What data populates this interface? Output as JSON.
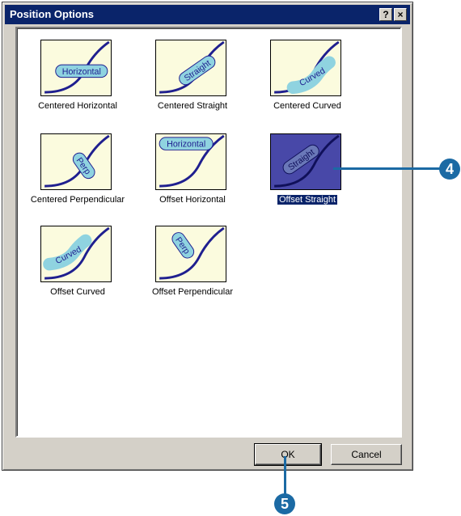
{
  "dialog": {
    "title": "Position Options",
    "help_label": "?",
    "close_label": "×"
  },
  "options": [
    {
      "label": "Centered Horizontal",
      "badge": "Horizontal",
      "selected": false
    },
    {
      "label": "Centered Straight",
      "badge": "Straight",
      "selected": false
    },
    {
      "label": "Centered Curved",
      "badge": "Curved",
      "selected": false
    },
    {
      "label": "Centered Perpendicular",
      "badge": "Perp",
      "selected": false
    },
    {
      "label": "Offset Horizontal",
      "badge": "Horizontal",
      "selected": false
    },
    {
      "label": "Offset Straight",
      "badge": "Straight",
      "selected": true
    },
    {
      "label": "Offset Curved",
      "badge": "Curved",
      "selected": false
    },
    {
      "label": "Offset Perpendicular",
      "badge": "Perp",
      "selected": false
    }
  ],
  "buttons": {
    "ok": "OK",
    "cancel": "Cancel"
  },
  "callouts": {
    "step4": "4",
    "step5": "5"
  },
  "colors": {
    "titlebar": "#0a246a",
    "thumb_bg": "#fbfbde",
    "curve": "#1f1f8f",
    "badge": "#8fd3e0",
    "callout": "#1b6aa4"
  }
}
